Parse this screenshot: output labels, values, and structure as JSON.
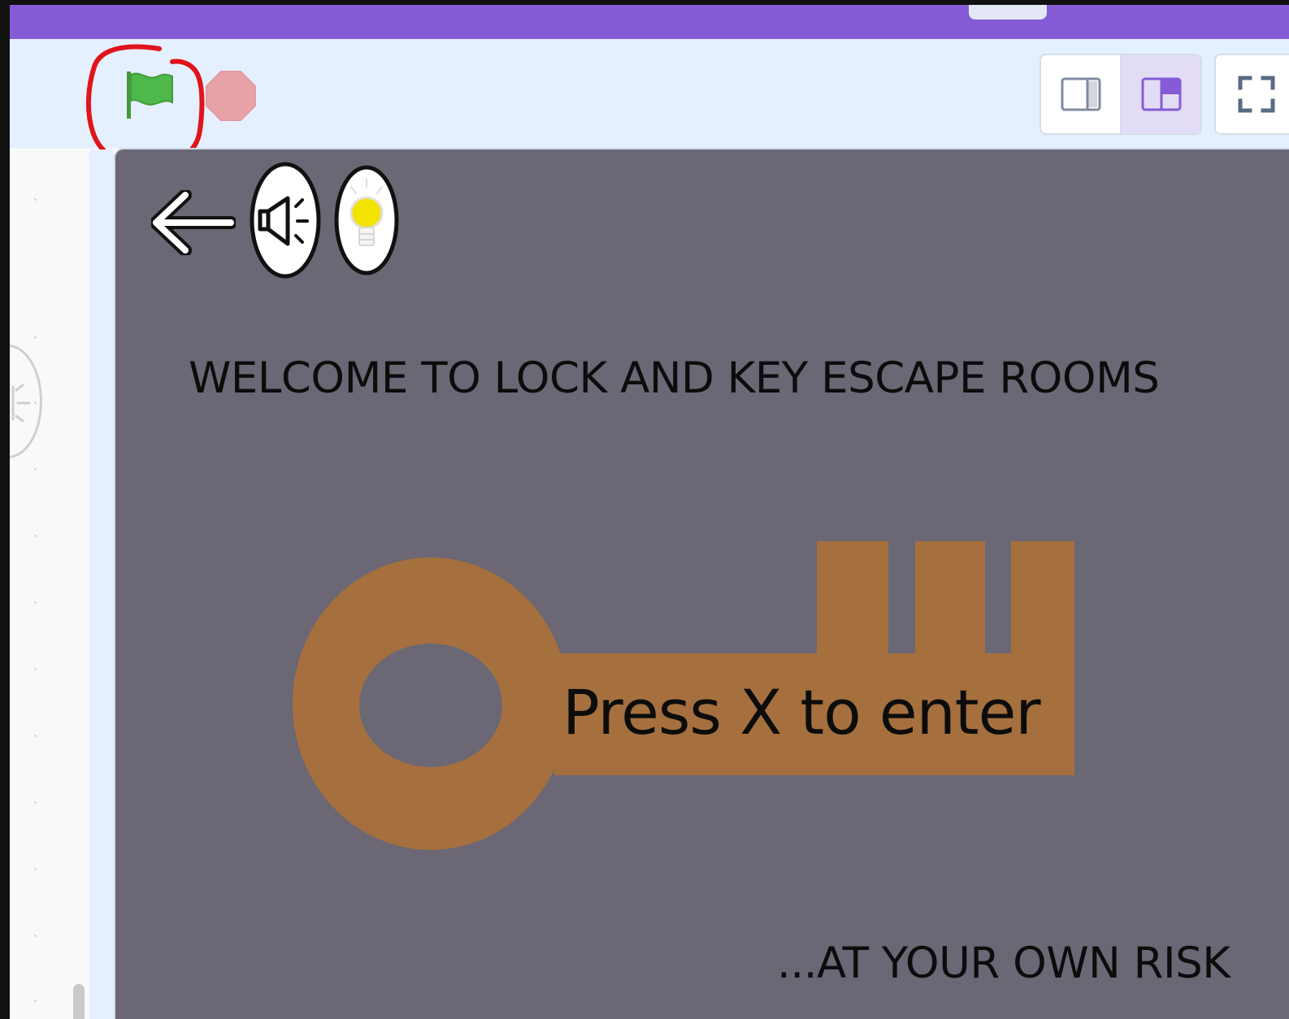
{
  "toolbar": {
    "green_flag_icon": "green-flag-icon",
    "stop_icon": "stop-sign-icon",
    "annotation": "red hand-drawn circle around green flag",
    "layout_modes": [
      "small-stage-icon",
      "normal-stage-icon"
    ],
    "active_layout_mode": "normal-stage-icon",
    "fullscreen_icon": "fullscreen-icon"
  },
  "stage": {
    "heading": "WELCOME TO LOCK AND KEY ESCAPE ROOMS",
    "key_text": "Press X to enter",
    "footer": "...AT YOUR OWN RISK",
    "icons": [
      "back-arrow-icon",
      "speaker-icon",
      "lightbulb-icon"
    ],
    "background_color": "#6b6774",
    "key_color": "#a5703e"
  },
  "colors": {
    "menubar": "#855cd6",
    "header_bg": "#e5f0ff",
    "flag_green": "#4cb94a",
    "stop_red": "#e8a3a8",
    "annotation_red": "#e0141b"
  }
}
